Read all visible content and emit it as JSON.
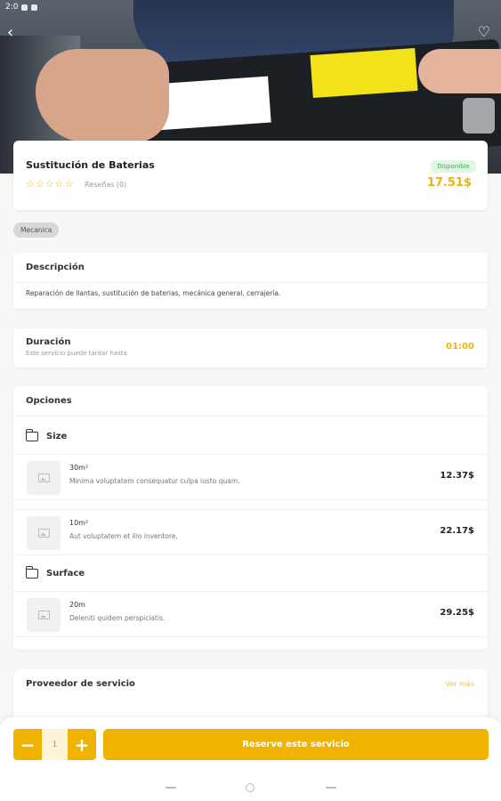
{
  "status_bar": {
    "time": "2:0"
  },
  "service": {
    "name": "Sustitución de Baterias",
    "stars": "☆☆☆☆☆",
    "reviews": "Reseñas (0)",
    "availability": "Disponible",
    "price": "17.51$"
  },
  "category": "Mecanica",
  "description": {
    "title": "Descripción",
    "text": "Reparación de llantas, sustitución de baterias, mecánica general, cerrajería."
  },
  "duration": {
    "title": "Duración",
    "subtitle": "Este servicio puede tardar hasta",
    "value": "01:00"
  },
  "options": {
    "title": "Opciones",
    "groups": [
      {
        "name": "Size",
        "items": [
          {
            "name": "30m²",
            "desc": "Minima voluptatem consequatur culpa iusto quam.",
            "price": "12.37$"
          },
          {
            "name": "10m²",
            "desc": "Aut voluptatem et illo inventore.",
            "price": "22.17$"
          }
        ]
      },
      {
        "name": "Surface",
        "items": [
          {
            "name": "20m",
            "desc": "Deleniti quidem perspiciatis.",
            "price": "29.25$"
          }
        ]
      }
    ]
  },
  "provider": {
    "title": "Proveedor de servicio",
    "more": "Ver más"
  },
  "bottom": {
    "quantity": "1",
    "minus": "−",
    "plus": "+",
    "reserve": "Reserve este servicio"
  },
  "colors": {
    "accent": "#f0b400",
    "available_bg": "#e3f6e6",
    "available_fg": "#3fae4f"
  }
}
